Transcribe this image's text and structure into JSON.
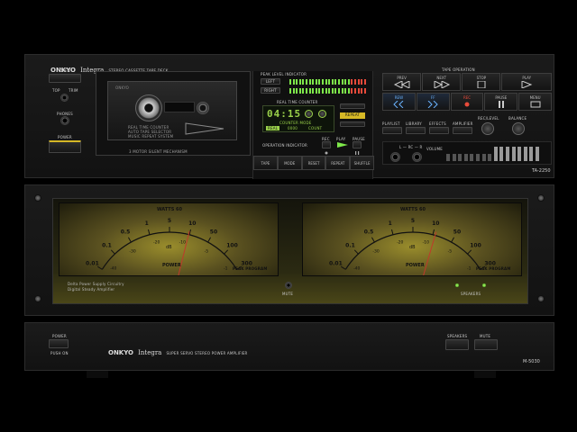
{
  "deck": {
    "brand": "ONKYO",
    "series": "Integra",
    "tagline": "STEREO CASSETTE TAPE DECK",
    "open_label": "OPEN",
    "top_label": "TOP",
    "trim_label": "TRIM",
    "phones_label": "PHONES",
    "power_label": "POWER",
    "mechanism_label": "3 MOTOR SILENT MECHANISM",
    "cassette_brand": "ONKYO",
    "cassette_notes": [
      "REAL TIME COUNTER",
      "AUTO TAPE SELECTOR",
      "MUSIC REPEAT SYSTEM"
    ],
    "peak_level_label": "PEAK LEVEL INDICATOR",
    "left_label": "LEFT",
    "right_label": "RIGHT",
    "counter_title": "REAL TIME COUNTER",
    "counter_value": "04:15",
    "counter_mode_label": "COUNTER MODE",
    "counter_modes": [
      "REAL",
      "0000",
      "COUNT"
    ],
    "repeat_led": "REPEAT",
    "op_indicator_label": "OPERATION INDICATOR",
    "rec_label": "REC",
    "play_label": "PLAY",
    "pause_label": "PAUSE",
    "bottom_buttons": [
      "TAPE",
      "MODE",
      "RESET",
      "REPEAT",
      "SHUFFLE"
    ],
    "model": "TA-2250",
    "tape_op_label": "TAPE OPERATION",
    "transport": {
      "row1": [
        "PREV",
        "NEXT",
        "STOP",
        "PLAY"
      ],
      "row2": [
        "REW",
        "FF",
        "REC",
        "PAUSE",
        "MENU"
      ]
    },
    "func_buttons": [
      "PLAYLIST",
      "LIBRARY",
      "EFFECTS",
      "AMPLIFIER"
    ],
    "rec_level_label": "REC/LEVEL",
    "balance_label": "BALANCE",
    "volume_label": "VOLUME",
    "lr_label": "L — RC — R",
    "colors": {
      "lcd": "#9ad14a",
      "led_green": "#7ee84a",
      "led_red": "#e84a3a",
      "accent_yellow": "#d6b826"
    }
  },
  "amp_meters": {
    "left": {
      "watts_label": "WATTS 60",
      "scale": [
        "0.01",
        "0.1",
        "0.5",
        "1",
        "5",
        "10",
        "50",
        "100",
        "300"
      ],
      "db_scale": [
        "-40",
        "-30",
        "-20",
        "-10",
        "-5",
        "-1"
      ],
      "db_label": "dB",
      "power_label": "POWER",
      "peak_label": "PEAK PROGRAM",
      "needle_level": 0.62
    },
    "right": {
      "watts_label": "WATTS 60",
      "scale": [
        "0.01",
        "0.1",
        "0.5",
        "1",
        "5",
        "10",
        "50",
        "100",
        "300"
      ],
      "db_scale": [
        "-40",
        "-30",
        "-20",
        "-10",
        "-5",
        "-1"
      ],
      "db_label": "dB",
      "power_label": "POWER",
      "peak_label": "PEAK PROGRAM",
      "needle_level": 0.64
    },
    "bottom_text": [
      "Delta Power Supply Circuitry",
      "Digital Steady Amplifier"
    ],
    "mute_label": "MUTE",
    "speakers_label": "SPEAKERS"
  },
  "amp": {
    "power_label": "POWER",
    "push_on_label": "PUSH ON",
    "brand": "ONKYO",
    "series": "Integra",
    "tagline": "SUPER SERVO STEREO POWER AMPLIFIER",
    "speakers_label": "SPEAKERS",
    "mute_label": "MUTE",
    "model": "M-5030"
  }
}
